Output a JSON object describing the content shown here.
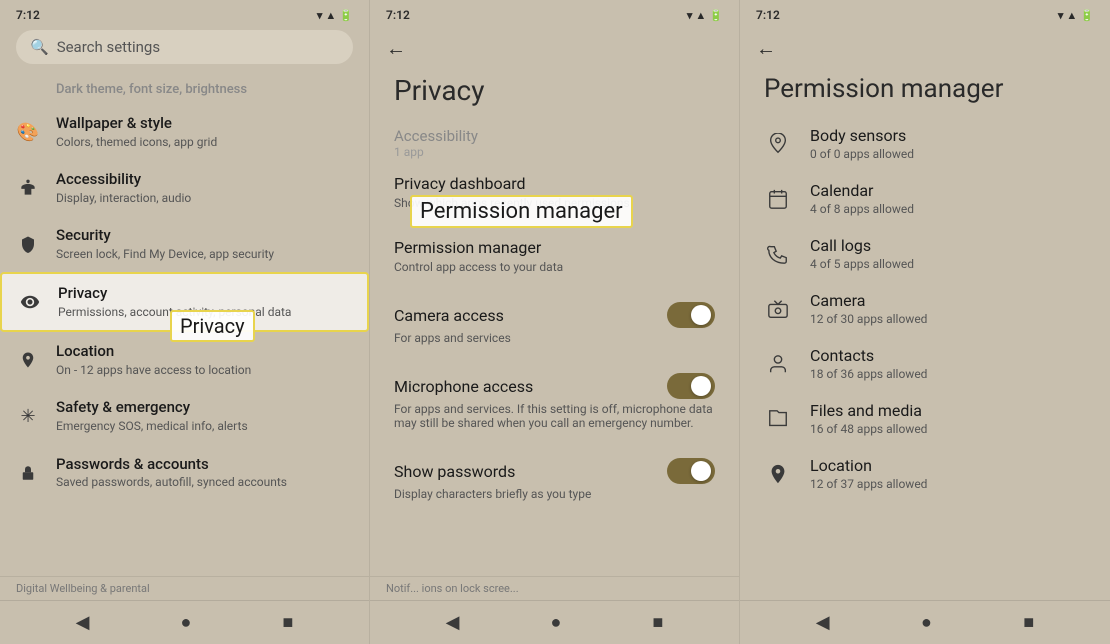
{
  "panels": [
    {
      "id": "settings",
      "statusTime": "7:12",
      "showSearch": true,
      "searchPlaceholder": "Search settings",
      "items": [
        {
          "icon": "🎨",
          "title": "Wallpaper & style",
          "subtitle": "Colors, themed icons, app grid",
          "iconName": "wallpaper-icon"
        },
        {
          "icon": "♿",
          "title": "Accessibility",
          "subtitle": "Display, interaction, audio",
          "iconName": "accessibility-icon"
        },
        {
          "icon": "🔒",
          "title": "Security",
          "subtitle": "Screen lock, Find My Device, app security",
          "iconName": "security-icon",
          "highlight": false
        },
        {
          "icon": "👁",
          "title": "Privacy",
          "subtitle": "Permissions, account activity, personal data",
          "iconName": "privacy-icon",
          "highlight": true
        },
        {
          "icon": "📍",
          "title": "Location",
          "subtitle": "On - 12 apps have access to location",
          "iconName": "location-icon"
        },
        {
          "icon": "🚨",
          "title": "Safety & emergency",
          "subtitle": "Emergency SOS, medical info, alerts",
          "iconName": "safety-icon"
        },
        {
          "icon": "🔑",
          "title": "Passwords & accounts",
          "subtitle": "Saved passwords, autofill, synced accounts",
          "iconName": "passwords-icon"
        }
      ],
      "annotationLabel": "Privacy",
      "bottomScrollText": "Digital Wellbeing & parental",
      "bottomNav": [
        "◀",
        "●",
        "■"
      ]
    },
    {
      "id": "privacy",
      "statusTime": "7:12",
      "showBack": true,
      "pageTitle": "Privacy",
      "fadedTop": "Accessibility",
      "fadedTopSub": "1 app",
      "items": [
        {
          "title": "Privacy dashboard",
          "subtitle": "Show which apps recently used permissions",
          "iconName": "privacy-dashboard-item",
          "hasToggle": false
        },
        {
          "title": "Permission manager",
          "subtitle": "Control app access to your data",
          "iconName": "permission-manager-item",
          "hasToggle": false,
          "highlight": true
        },
        {
          "title": "Camera access",
          "subtitle": "For apps and services",
          "iconName": "camera-access-item",
          "hasToggle": true
        },
        {
          "title": "Microphone access",
          "subtitle": "For apps and services. If this setting is off, microphone data may still be shared when you call an emergency number.",
          "iconName": "microphone-access-item",
          "hasToggle": true
        },
        {
          "title": "Show passwords",
          "subtitle": "Display characters briefly as you type",
          "iconName": "show-passwords-item",
          "hasToggle": true
        }
      ],
      "annotationLabel": "Permission manager",
      "bottomScrollText": "Notif... ions on lock scree...",
      "bottomNav": [
        "◀",
        "●",
        "■"
      ]
    },
    {
      "id": "permissionManager",
      "statusTime": "7:12",
      "showBack": true,
      "pageTitle": "Permission manager",
      "items": [
        {
          "icon": "♥",
          "iconName": "body-sensors-icon",
          "title": "Body sensors",
          "subtitle": "0 of 0 apps allowed"
        },
        {
          "icon": "📅",
          "iconName": "calendar-icon",
          "title": "Calendar",
          "subtitle": "4 of 8 apps allowed"
        },
        {
          "icon": "📋",
          "iconName": "call-logs-icon",
          "title": "Call logs",
          "subtitle": "4 of 5 apps allowed"
        },
        {
          "icon": "📷",
          "iconName": "camera-perm-icon",
          "title": "Camera",
          "subtitle": "12 of 30 apps allowed"
        },
        {
          "icon": "👤",
          "iconName": "contacts-icon",
          "title": "Contacts",
          "subtitle": "18 of 36 apps allowed"
        },
        {
          "icon": "📁",
          "iconName": "files-media-icon",
          "title": "Files and media",
          "subtitle": "16 of 48 apps allowed"
        },
        {
          "icon": "📍",
          "iconName": "location-perm-icon",
          "title": "Location",
          "subtitle": "12 of 37 apps allowed"
        }
      ],
      "bottomNav": [
        "◀",
        "●",
        "■"
      ]
    }
  ],
  "icons": {
    "wifi": "▾",
    "signal": "▲",
    "battery": "🔋",
    "search": "🔍",
    "back": "←"
  },
  "colors": {
    "background": "#c8bfae",
    "highlight": "#e8d44d",
    "toggleOn": "#7a6a3a",
    "text": "#1a1a1a",
    "subtitle": "#555555"
  }
}
